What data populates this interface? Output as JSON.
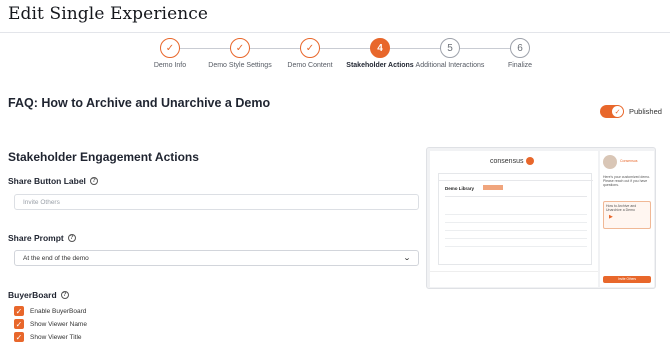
{
  "page": {
    "title": "Edit Single Experience"
  },
  "stepper": {
    "steps": [
      {
        "label": "Demo Info",
        "state": "done",
        "number": ""
      },
      {
        "label": "Demo Style Settings",
        "state": "done",
        "number": ""
      },
      {
        "label": "Demo Content",
        "state": "done",
        "number": ""
      },
      {
        "label": "Stakeholder Actions",
        "state": "active",
        "number": "4"
      },
      {
        "label": "Additional Interactions",
        "state": "todo",
        "number": "5"
      },
      {
        "label": "Finalize",
        "state": "todo",
        "number": "6"
      }
    ],
    "check_icon": "check-icon"
  },
  "faq": {
    "title": "FAQ: How to Archive and Unarchive a Demo"
  },
  "publish": {
    "label": "Published",
    "on": true
  },
  "section": {
    "title": "Stakeholder Engagement Actions"
  },
  "share_button": {
    "label": "Share Button Label",
    "placeholder": "Invite Others"
  },
  "share_prompt": {
    "label": "Share Prompt",
    "value": "At the end of the demo"
  },
  "buyerboard": {
    "label": "BuyerBoard",
    "options": [
      {
        "label": "Enable BuyerBoard",
        "checked": true
      },
      {
        "label": "Show Viewer Name",
        "checked": true
      },
      {
        "label": "Show Viewer Title",
        "checked": true
      }
    ]
  },
  "preview": {
    "logo_text": "consensus",
    "screen_heading": "Demo Library",
    "side_name": "Consensus",
    "side_greeting": "Here's your customized demo. Please reach out if you have questions.",
    "card_text": "How to Archive and Unarchive a Demo",
    "button_label": "Invite Others"
  },
  "colors": {
    "accent": "#e8672b",
    "text": "#1f2430",
    "border": "#dcdfe4"
  }
}
